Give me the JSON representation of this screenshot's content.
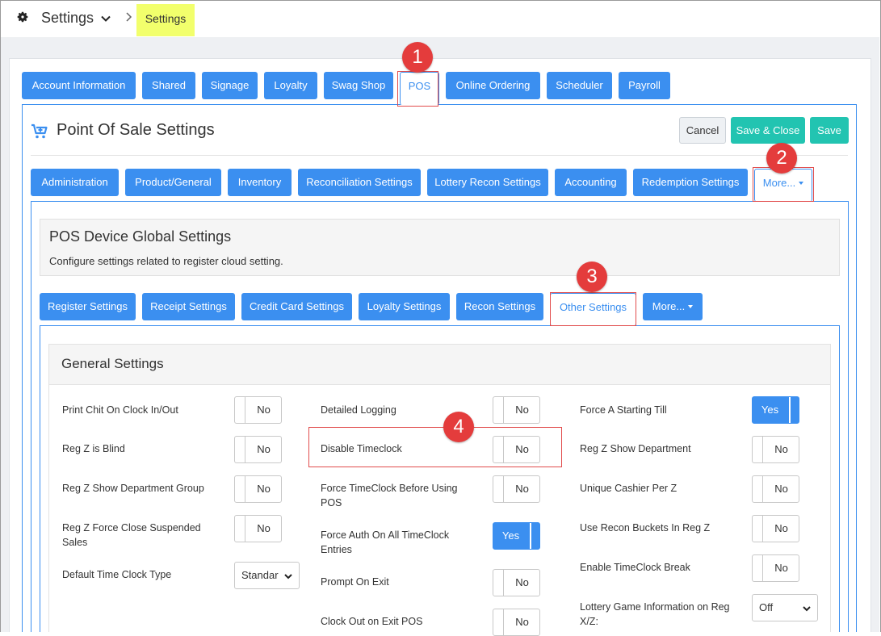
{
  "header": {
    "title": "Settings",
    "breadcrumb": "Settings"
  },
  "main_tabs": [
    "Account Information",
    "Shared",
    "Signage",
    "Loyalty",
    "Swag Shop",
    "POS",
    "Online Ordering",
    "Scheduler",
    "Payroll"
  ],
  "pos": {
    "title": "Point Of Sale Settings",
    "cancel_label": "Cancel",
    "save_close_label": "Save & Close",
    "save_label": "Save"
  },
  "pos_tabs": [
    "Administration",
    "Product/General",
    "Inventory",
    "Reconciliation Settings",
    "Lottery Recon Settings",
    "Accounting",
    "Redemption Settings",
    "More..."
  ],
  "device": {
    "title": "POS Device Global Settings",
    "description": "Configure settings related to register cloud setting."
  },
  "device_tabs": [
    "Register Settings",
    "Receipt Settings",
    "Credit Card Settings",
    "Loyalty Settings",
    "Recon Settings",
    "Other Settings",
    "More..."
  ],
  "general": {
    "title": "General Settings",
    "col1": [
      {
        "label": "Print Chit On Clock In/Out",
        "value": "No"
      },
      {
        "label": "Reg Z is Blind",
        "value": "No"
      },
      {
        "label": "Reg Z Show Department Group",
        "value": "No"
      },
      {
        "label": "Reg Z Force Close Suspended Sales",
        "value": "No"
      },
      {
        "label": "Default Time Clock Type",
        "value": "Standar"
      }
    ],
    "col2": [
      {
        "label": "Detailed Logging",
        "value": "No"
      },
      {
        "label": "Disable Timeclock",
        "value": "No"
      },
      {
        "label": "Force TimeClock Before Using POS",
        "value": "No"
      },
      {
        "label": "Force Auth On All TimeClock Entries",
        "value": "Yes"
      },
      {
        "label": "Prompt On Exit",
        "value": "No"
      },
      {
        "label": "Clock Out on Exit POS",
        "value": "No"
      }
    ],
    "col3": [
      {
        "label": "Force A Starting Till",
        "value": "Yes"
      },
      {
        "label": "Reg Z Show Department",
        "value": "No"
      },
      {
        "label": "Unique Cashier Per Z",
        "value": "No"
      },
      {
        "label": "Use Recon Buckets In Reg Z",
        "value": "No"
      },
      {
        "label": "Enable TimeClock Break",
        "value": "No"
      },
      {
        "label": "Lottery Game Information on Reg X/Z:",
        "value": "Off"
      }
    ]
  },
  "callouts": [
    "1",
    "2",
    "3",
    "4"
  ],
  "colors": {
    "primary": "#3b8ff0",
    "teal": "#22c4b1",
    "highlight": "#f2ff6c",
    "callout": "#e43c3c"
  }
}
